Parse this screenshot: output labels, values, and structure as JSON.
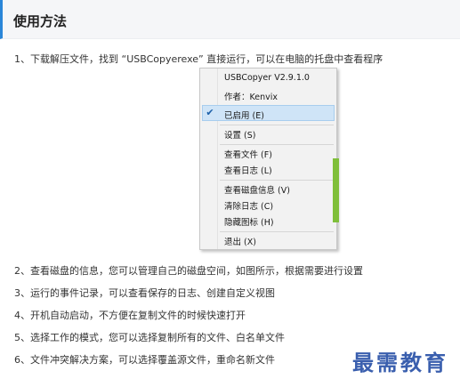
{
  "section": {
    "title": "使用方法"
  },
  "steps": [
    "1、下载解压文件，找到 “USBCopyerexe” 直接运行，可以在电脑的托盘中查看程序",
    "2、查看磁盘的信息，您可以管理自己的磁盘空间，如图所示，根据需要进行设置",
    "3、运行的事件记录，可以查看保存的日志、创建自定义视图",
    "4、开机自动启动，不方便在复制文件的时候快速打开",
    "5、选择工作的模式，您可以选择复制所有的文件、白名单文件",
    "6、文件冲突解决方案，可以选择覆盖源文件，重命名新文件"
  ],
  "menu": {
    "app_name": "USBCopyer V2.9.1.0",
    "author": "作者：Kenvix",
    "enabled": "已启用 (E)",
    "settings": "设置 (S)",
    "view_files": "查看文件 (F)",
    "view_log": "查看日志 (L)",
    "disk_info": "查看磁盘信息 (V)",
    "clear_log": "清除日志 (C)",
    "hide_icon": "隐藏图标 (H)",
    "exit": "退出 (X)"
  },
  "icons": {
    "check": "checkmark-icon"
  },
  "watermark": "最需教育",
  "colors": {
    "accent": "#2a86d8",
    "watermark": "#3a5fae",
    "menu_highlight": "#cfe4f7"
  }
}
